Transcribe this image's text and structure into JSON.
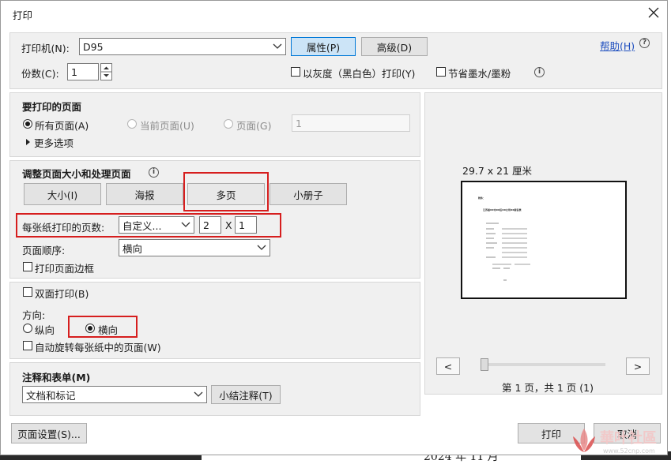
{
  "window": {
    "title": "打印"
  },
  "printer": {
    "label": "打印机(N):",
    "value": "D95",
    "properties_button": "属性(P)",
    "advanced_button": "高级(D)",
    "help_link": "帮助(H)",
    "copies_label": "份数(C):",
    "copies_value": "1",
    "grayscale_label": "以灰度（黑白色）打印(Y)",
    "save_ink_label": "节省墨水/墨粉"
  },
  "pages_to_print": {
    "heading": "要打印的页面",
    "all_pages": "所有页面(A)",
    "current_page": "当前页面(U)",
    "pages": "页面(G)",
    "pages_value": "1",
    "more_options": "更多选项"
  },
  "page_handling": {
    "heading": "调整页面大小和处理页面",
    "tabs": [
      "大小(I)",
      "海报",
      "多页",
      "小册子"
    ],
    "selected_tab": "多页",
    "pages_per_sheet_label": "每张纸打印的页数:",
    "pages_per_sheet_value": "自定义...",
    "cols_value": "2",
    "times": "X",
    "rows_value": "1",
    "page_order_label": "页面顺序:",
    "page_order_value": "横向",
    "print_border_label": "打印页面边框"
  },
  "duplex": {
    "label": "双面打印(B)",
    "orientation_label": "方向:",
    "portrait": "纵向",
    "landscape": "横向",
    "selected": "横向",
    "auto_rotate_label": "自动旋转每张纸中的页面(W)"
  },
  "comments": {
    "heading": "注释和表单(M)",
    "value": "文档和标记",
    "summarize_button": "小结注释(T)"
  },
  "preview": {
    "size_label": "29.7 x 21 厘米",
    "prev": "<",
    "next": ">",
    "slider_value": 0,
    "page_status": "第 1 页，共 1 页 (1)",
    "doc_lines": [
      "附件：",
      "江苏省XX市XX区XX公司XX报名表"
    ]
  },
  "footer": {
    "page_setup_button": "页面设置(S)...",
    "print_button": "打印",
    "cancel_button": "取消"
  },
  "background": {
    "partial_text": "2024 年 11 月",
    "watermark_text": "華叶社區",
    "watermark_url": "www.52cnp.com"
  }
}
